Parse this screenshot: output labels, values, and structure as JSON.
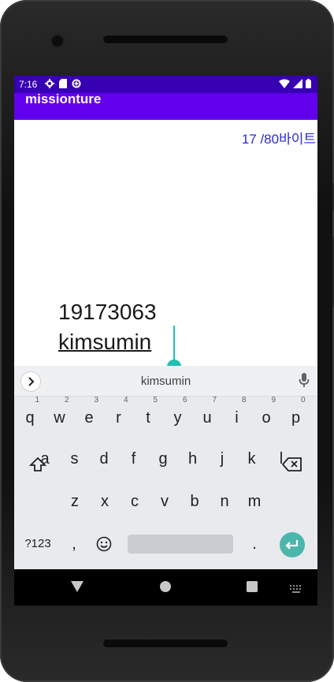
{
  "status": {
    "time": "7:16"
  },
  "app": {
    "title": "missionture"
  },
  "counter": "17 /80바이트",
  "edit_text": {
    "line1": "19173063",
    "line2": "kimsumin"
  },
  "suggestion": "kimsumin",
  "keyboard": {
    "row1": [
      {
        "k": "q",
        "h": "1"
      },
      {
        "k": "w",
        "h": "2"
      },
      {
        "k": "e",
        "h": "3"
      },
      {
        "k": "r",
        "h": "4"
      },
      {
        "k": "t",
        "h": "5"
      },
      {
        "k": "y",
        "h": "6"
      },
      {
        "k": "u",
        "h": "7"
      },
      {
        "k": "i",
        "h": "8"
      },
      {
        "k": "o",
        "h": "9"
      },
      {
        "k": "p",
        "h": "0"
      }
    ],
    "row2": [
      "a",
      "s",
      "d",
      "f",
      "g",
      "h",
      "j",
      "k",
      "l"
    ],
    "row3": [
      "z",
      "x",
      "c",
      "v",
      "b",
      "n",
      "m"
    ],
    "symbols_label": "?123",
    "comma": ",",
    "period": "."
  },
  "colors": {
    "status": "#3700b3",
    "appbar": "#6200ee",
    "accent": "#20c0b0",
    "counter": "#2a2ad8"
  },
  "icons": [
    "settings-icon",
    "sd-card-icon",
    "data-saver-icon",
    "wifi-icon",
    "signal-icon",
    "battery-icon",
    "chevron-right-icon",
    "mic-icon",
    "shift-icon",
    "backspace-icon",
    "emoji-icon",
    "enter-icon",
    "back-icon",
    "home-icon",
    "recents-icon",
    "keyboard-switch-icon"
  ]
}
